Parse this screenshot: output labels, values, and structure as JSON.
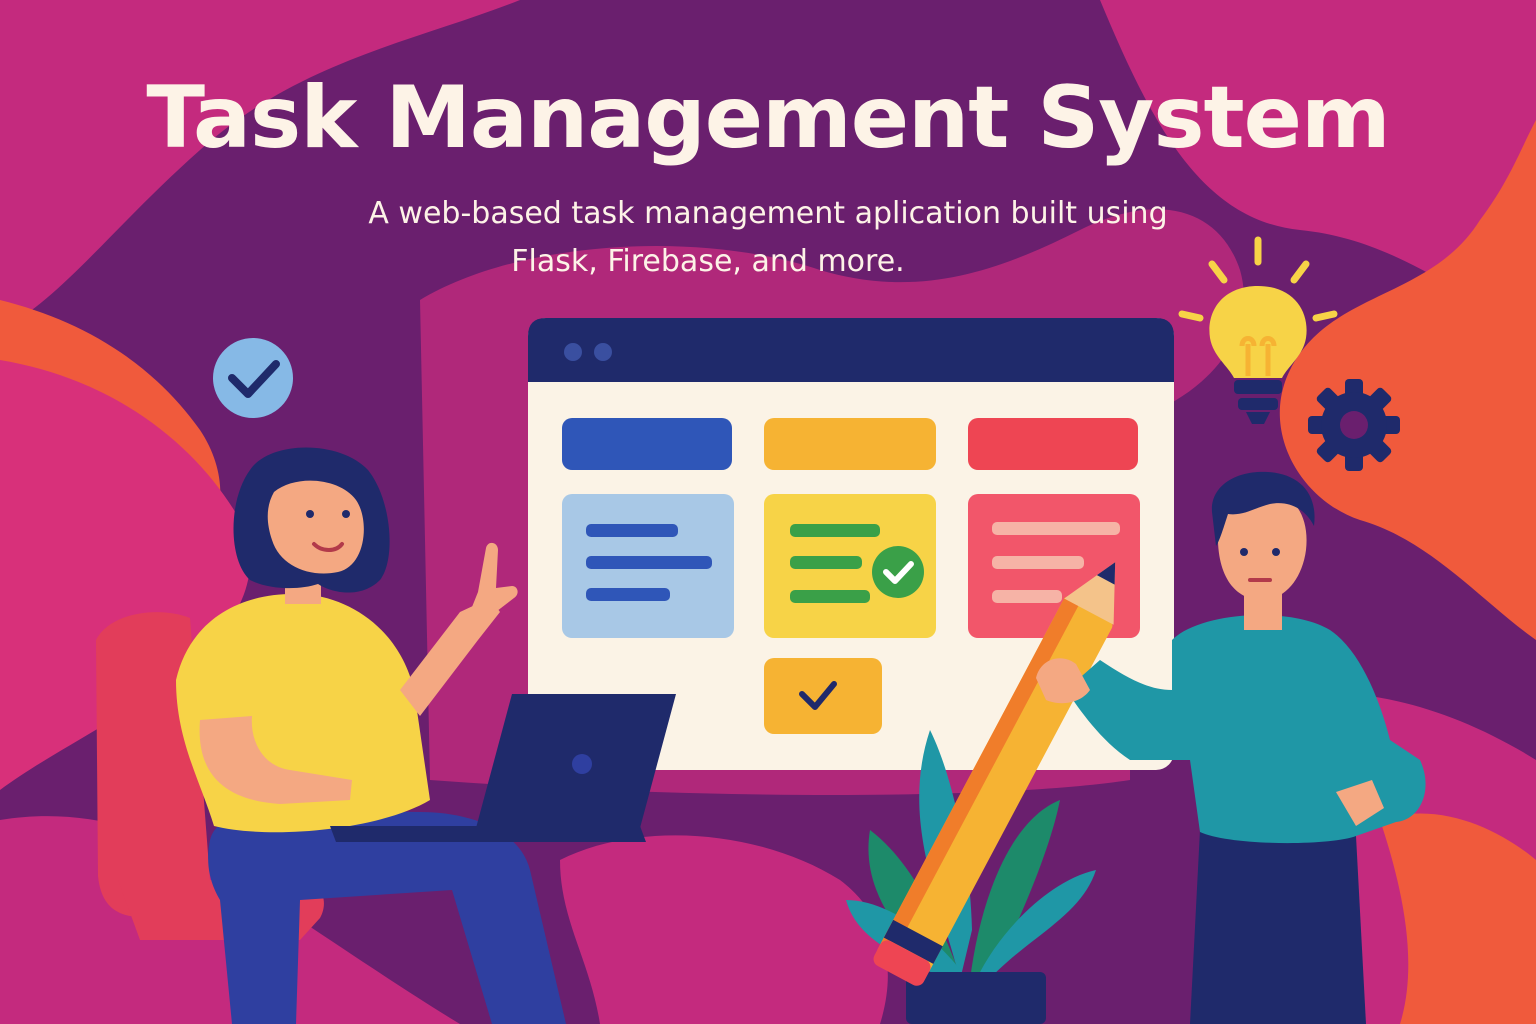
{
  "header": {
    "title": "Task Management System",
    "subtitle_line_1": "A web-based task management aplication built using",
    "subtitle_line_2": "Flask, Firebase, and more."
  },
  "colors": {
    "background_purple": "#6a1f6e",
    "magenta": "#c42a7e",
    "orange": "#f05a3c",
    "title_text": "#fdf3e7",
    "navy": "#1f2a6b",
    "window_body": "#fbf3e6",
    "blue": "#2f56b8",
    "amber": "#f6b333",
    "red": "#ee4553",
    "teal": "#1f97a6",
    "yellow_shirt": "#f7d347"
  },
  "board": {
    "columns": [
      {
        "name": "todo",
        "header_color": "#2f56b8",
        "card_color": "#a8c8e6",
        "line_color": "#2f56b8"
      },
      {
        "name": "in-progress",
        "header_color": "#f6b333",
        "card_color": "#f7d347",
        "line_color": "#3aa048"
      },
      {
        "name": "done",
        "header_color": "#ee4553",
        "card_color": "#f2566a",
        "line_color": "#f6b3a6"
      }
    ]
  },
  "icons": [
    "check-badge-icon",
    "lightbulb-icon",
    "gear-icon",
    "pencil-icon",
    "laptop-icon",
    "plant-icon",
    "chair-icon"
  ]
}
